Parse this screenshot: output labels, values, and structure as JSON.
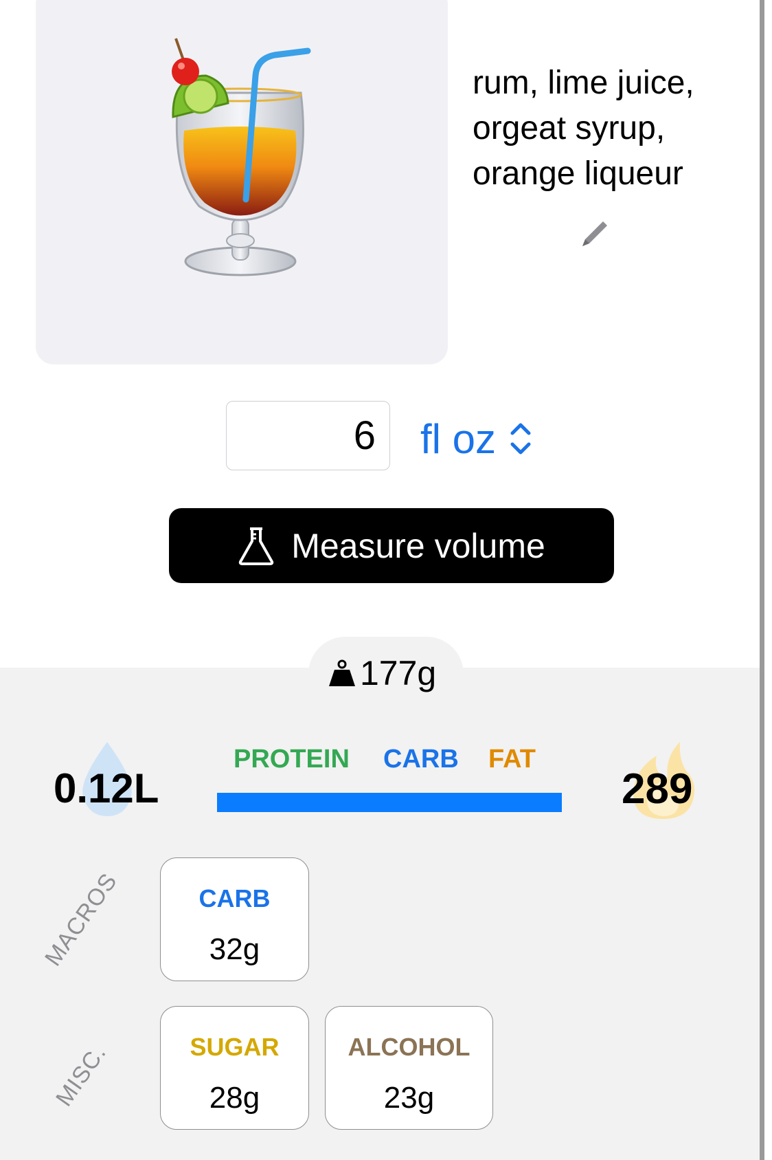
{
  "food": {
    "ingredients": "rum, lime juice, orgeat syrup, orange liqueur",
    "image_icon": "tropical-drink-icon",
    "edit_icon": "pencil-icon"
  },
  "serving": {
    "amount": "6",
    "unit": "fl oz",
    "unit_icon": "chevron-up-down-icon"
  },
  "measure_button": {
    "label": "Measure volume",
    "icon": "flask-icon"
  },
  "weight": {
    "value": "177g",
    "icon": "weight-icon"
  },
  "summary": {
    "volume": "0.12L",
    "volume_icon": "water-drop-icon",
    "calories": "289",
    "calories_icon": "flame-icon"
  },
  "macro_legend": {
    "protein": "PROTEIN",
    "carb": "CARB",
    "fat": "FAT"
  },
  "macro_bar": {
    "protein_fraction": 0,
    "carb_fraction": 1,
    "fat_fraction": 0
  },
  "sections": {
    "macros_label": "MACROS",
    "misc_label": "MISC."
  },
  "macros": [
    {
      "name": "CARB",
      "value": "32g"
    }
  ],
  "misc": [
    {
      "name": "SUGAR",
      "value": "28g"
    },
    {
      "name": "ALCOHOL",
      "value": "23g"
    }
  ],
  "colors": {
    "accent_blue": "#1a73e8",
    "protein": "#34a853",
    "carb": "#1a73e8",
    "fat": "#e08a00",
    "sugar": "#d4a800",
    "alcohol": "#8b7355",
    "button_bg": "#000000",
    "panel_bg": "#f2f2f2"
  }
}
